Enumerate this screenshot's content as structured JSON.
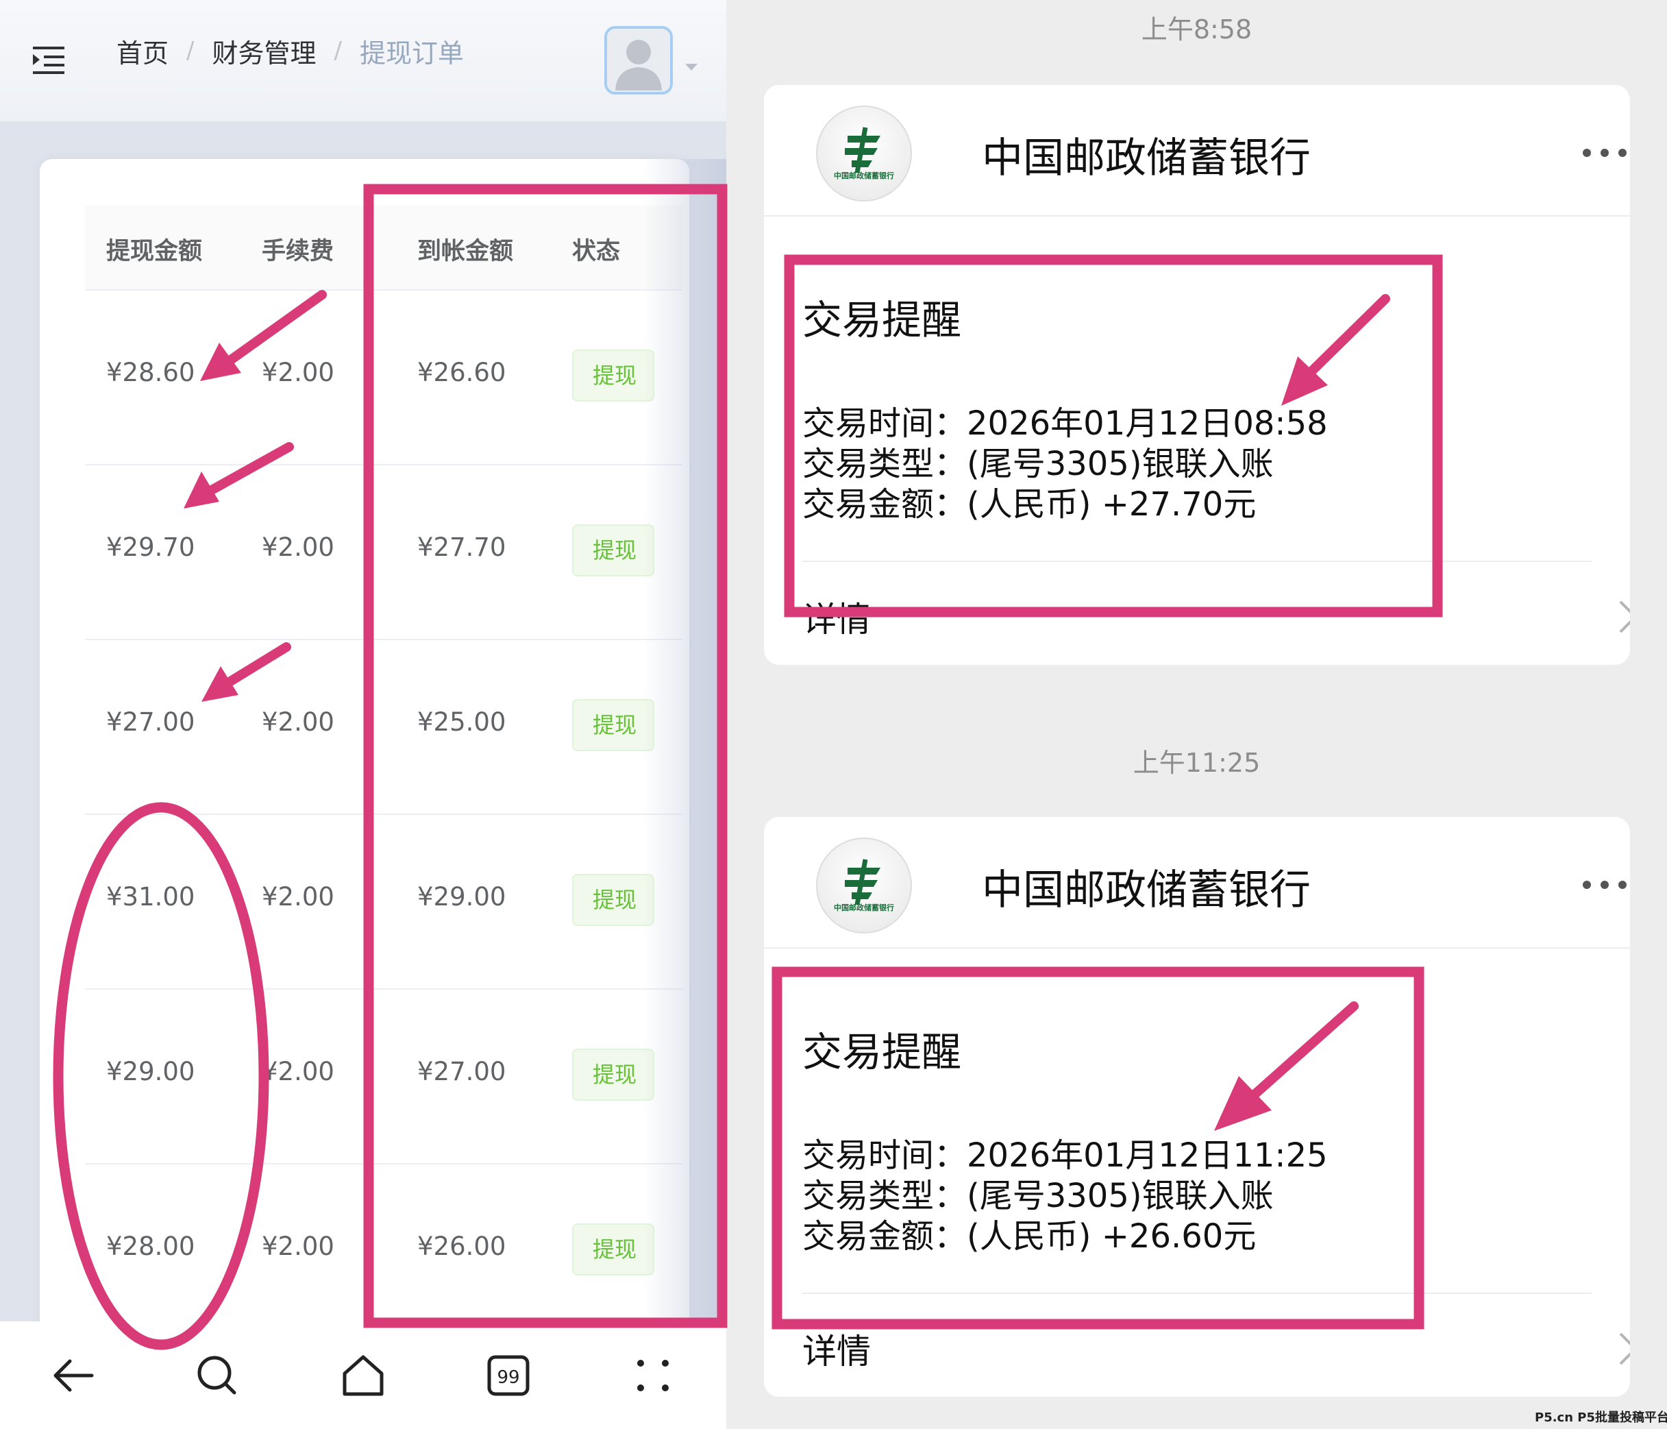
{
  "left_app": {
    "breadcrumb": [
      "首页",
      "财务管理",
      "提现订单"
    ],
    "breadcrumb_sep": "/",
    "table": {
      "headers": [
        "提现金额",
        "手续费",
        "到帐金额",
        "状态"
      ],
      "rows": [
        {
          "amount": "¥28.60",
          "fee": "¥2.00",
          "received": "¥26.60",
          "status": "提现"
        },
        {
          "amount": "¥29.70",
          "fee": "¥2.00",
          "received": "¥27.70",
          "status": "提现"
        },
        {
          "amount": "¥27.00",
          "fee": "¥2.00",
          "received": "¥25.00",
          "status": "提现"
        },
        {
          "amount": "¥31.00",
          "fee": "¥2.00",
          "received": "¥29.00",
          "status": "提现"
        },
        {
          "amount": "¥29.00",
          "fee": "¥2.00",
          "received": "¥27.00",
          "status": "提现"
        },
        {
          "amount": "¥28.00",
          "fee": "¥2.00",
          "received": "¥26.00",
          "status": "提现"
        }
      ]
    },
    "navbar_icons": [
      "back-arrow-icon",
      "search-icon",
      "home-icon",
      "tabs-count-icon",
      "more-dots-icon"
    ],
    "tabs_count": "99"
  },
  "right_chat": {
    "messages": [
      {
        "time": "上午8:58",
        "bank": "中国邮政储蓄银行",
        "logo_text": "中国邮政储蓄银行",
        "title": "交易提醒",
        "lines": [
          "交易时间：2026年01月12日08:58",
          "交易类型：(尾号3305)银联入账",
          "交易金额：(人民币) +27.70元"
        ],
        "detail": "详情"
      },
      {
        "time": "上午11:25",
        "bank": "中国邮政储蓄银行",
        "logo_text": "中国邮政储蓄银行",
        "title": "交易提醒",
        "lines": [
          "交易时间：2026年01月12日11:25",
          "交易类型：(尾号3305)银联入账",
          "交易金额：(人民币) +26.60元"
        ],
        "detail": "详情"
      }
    ]
  },
  "watermark": "P5.cn P5批量投稿平台",
  "colors": {
    "annotation": "#d93a78",
    "tag_green": "#67c23a",
    "postal_green": "#1a6d3a"
  }
}
